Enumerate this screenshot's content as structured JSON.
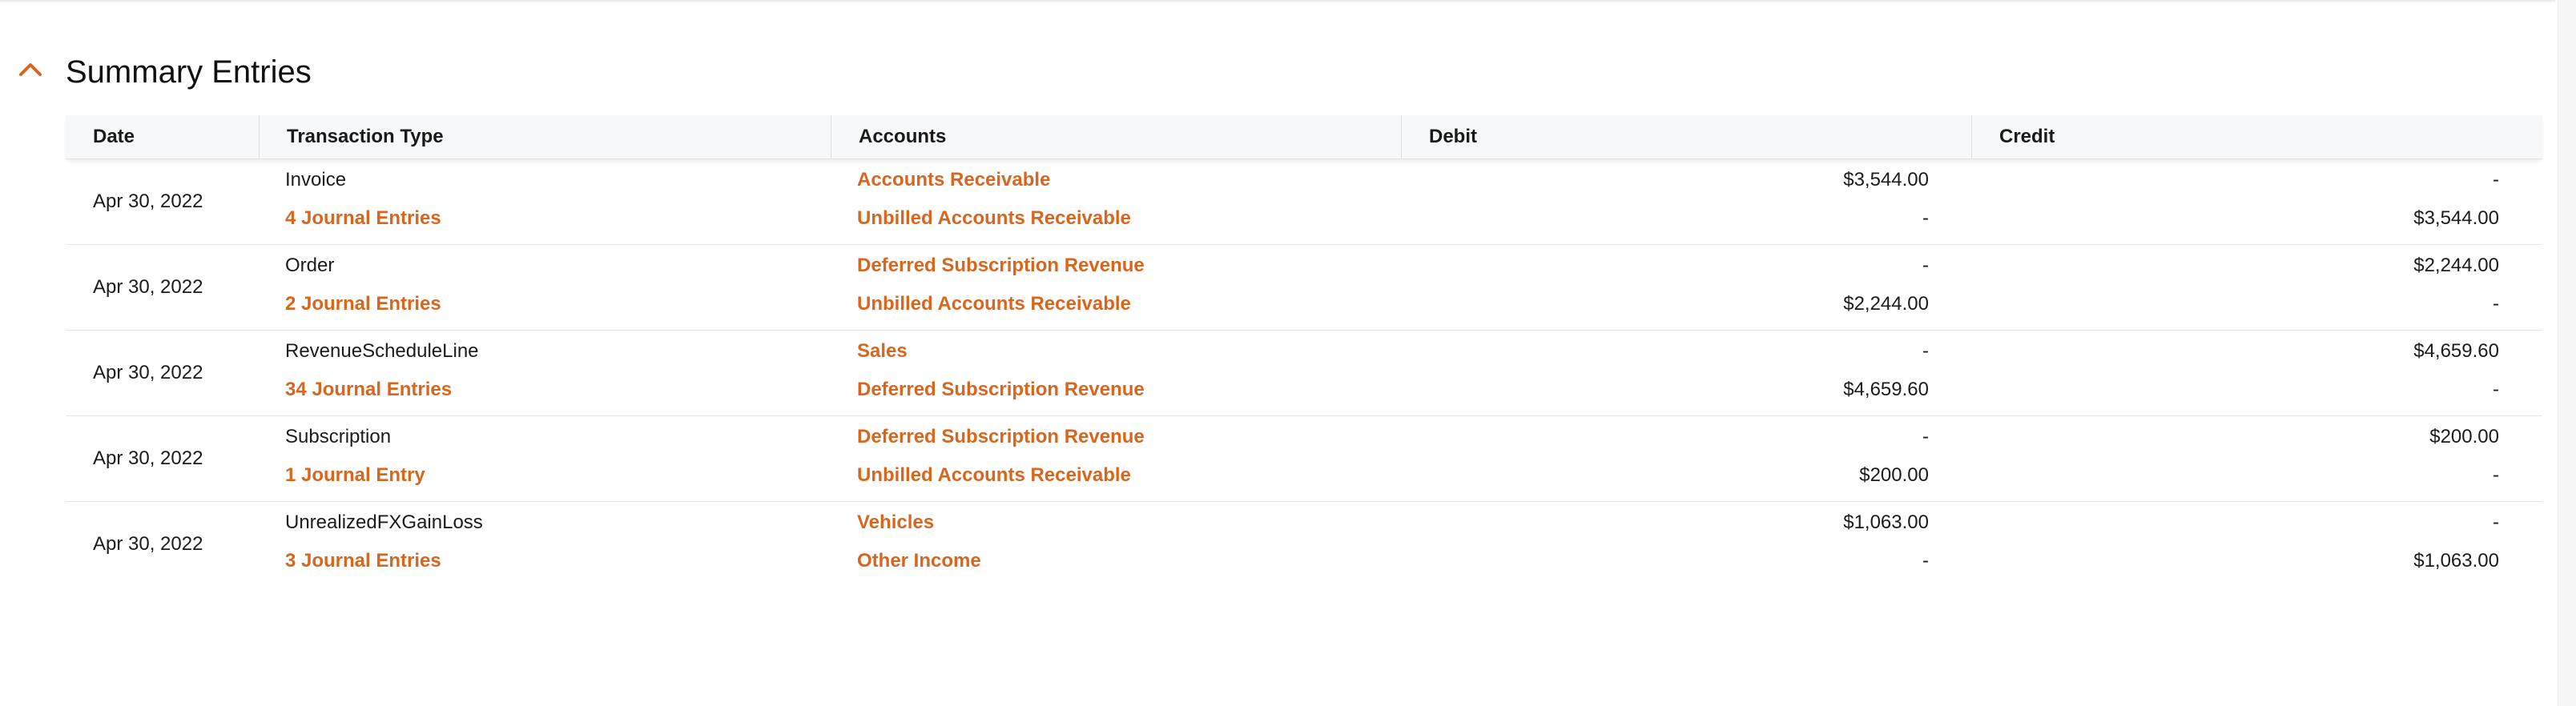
{
  "section": {
    "title": "Summary Entries"
  },
  "colors": {
    "accent": "#d9661f",
    "header_bg": "#f7f8f9"
  },
  "icons": {
    "collapse": "chevron-up-icon"
  },
  "table": {
    "columns": [
      "Date",
      "Transaction Type",
      "Accounts",
      "Debit",
      "Credit"
    ],
    "rows": [
      {
        "date": "Apr 30, 2022",
        "type": "Invoice",
        "journal": "4 Journal Entries",
        "accounts": [
          "Accounts Receivable",
          "Unbilled Accounts Receivable"
        ],
        "debit": [
          "$3,544.00",
          "-"
        ],
        "credit": [
          "-",
          "$3,544.00"
        ]
      },
      {
        "date": "Apr 30, 2022",
        "type": "Order",
        "journal": "2 Journal Entries",
        "accounts": [
          "Deferred Subscription Revenue",
          "Unbilled Accounts Receivable"
        ],
        "debit": [
          "-",
          "$2,244.00"
        ],
        "credit": [
          "$2,244.00",
          "-"
        ]
      },
      {
        "date": "Apr 30, 2022",
        "type": "RevenueScheduleLine",
        "journal": "34 Journal Entries",
        "accounts": [
          "Sales",
          "Deferred Subscription Revenue"
        ],
        "debit": [
          "-",
          "$4,659.60"
        ],
        "credit": [
          "$4,659.60",
          "-"
        ]
      },
      {
        "date": "Apr 30, 2022",
        "type": "Subscription",
        "journal": "1 Journal Entry",
        "accounts": [
          "Deferred Subscription Revenue",
          "Unbilled Accounts Receivable"
        ],
        "debit": [
          "-",
          "$200.00"
        ],
        "credit": [
          "$200.00",
          "-"
        ]
      },
      {
        "date": "Apr 30, 2022",
        "type": "UnrealizedFXGainLoss",
        "journal": "3 Journal Entries",
        "accounts": [
          "Vehicles",
          "Other Income"
        ],
        "debit": [
          "$1,063.00",
          "-"
        ],
        "credit": [
          "-",
          "$1,063.00"
        ]
      }
    ]
  }
}
